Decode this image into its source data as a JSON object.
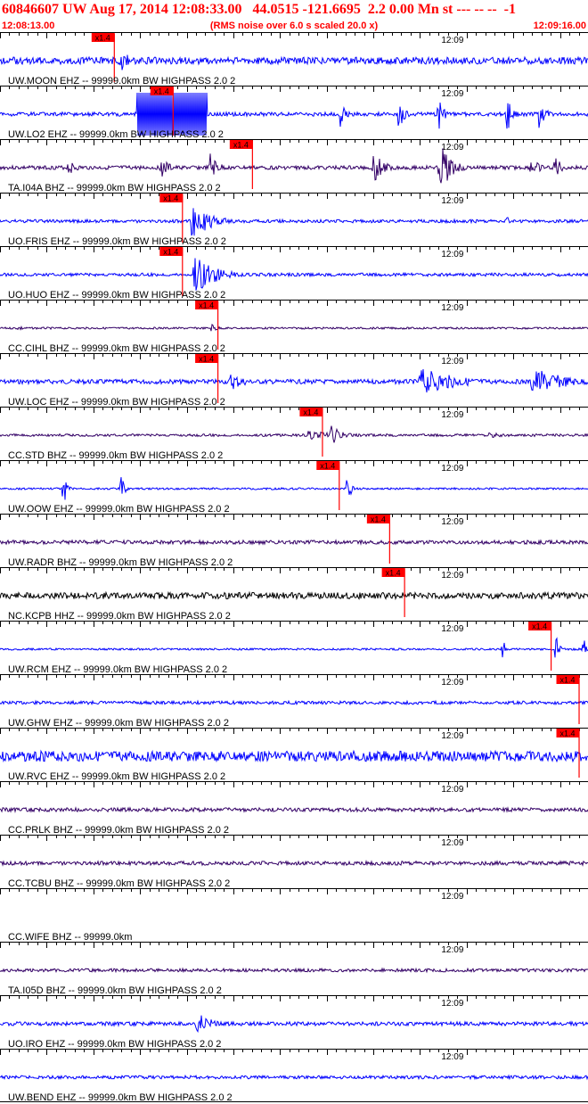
{
  "header": {
    "title": "60846607 UW Aug 17, 2014 12:08:33.00   44.0515 -121.6695  2.2 0.00 Mn st --- -- --  -1",
    "start_time": "12:08:13.00",
    "noise_note": "(RMS noise over 6.0 s scaled 20.0 x)",
    "end_time": "12:09:16.00"
  },
  "colors": {
    "header_text": "#ff0000",
    "trace_blue": "#0000ff",
    "trace_purple": "#330066",
    "trace_black": "#000000",
    "pick_marker": "#ff0000",
    "axis": "#000000"
  },
  "chart_data": {
    "type": "seismogram",
    "title": "60846607 UW Aug 17, 2014 12:08:33.00   44.0515 -121.6695  2.2 0.00 Mn st --- -- --  -1",
    "xlim": [
      "12:08:13.00",
      "12:09:16.00"
    ],
    "time_tick_label": "12:09",
    "pick_label": "x1.4",
    "grid": false,
    "traces": [
      {
        "label": "UW.MOON EHZ -- 99999.0km BW  HIGHPASS  2.0  2",
        "color": "#0000ff",
        "noise": 0.22,
        "pick": "12:08:25.2",
        "events": [
          {
            "t": "12:08:25.7",
            "amp": 1.0,
            "dur": 1.0
          }
        ]
      },
      {
        "label": "UW.LO2 EHZ -- 99999.0km BW  HIGHPASS  2.0  2",
        "color": "#0000ff",
        "noise": 0.12,
        "pick": "12:08:31.5",
        "clipped": true,
        "events": [
          {
            "t": "12:08:27.7",
            "t_end": "12:08:35.2",
            "amp": 3.0,
            "dur": 0.3,
            "saturated": true
          },
          {
            "t": "12:08:49.5",
            "amp": 1.3,
            "dur": 0.5
          },
          {
            "t": "12:08:55.7",
            "amp": 1.4,
            "dur": 0.5
          },
          {
            "t": "12:09:00.0",
            "amp": 1.3,
            "dur": 0.5
          },
          {
            "t": "12:09:07.3",
            "amp": 1.4,
            "dur": 0.5
          },
          {
            "t": "12:09:10.8",
            "amp": 1.3,
            "dur": 0.5
          }
        ]
      },
      {
        "label": "TA.I04A BHZ -- 99999.0km BW  HIGHPASS  2.0  2",
        "color": "#330066",
        "noise": 0.12,
        "pick": "12:08:40.0",
        "events": [
          {
            "t": "12:08:20.3",
            "amp": 0.5,
            "dur": 1.0
          },
          {
            "t": "12:08:30.3",
            "amp": 0.6,
            "dur": 1.0
          },
          {
            "t": "12:08:35.5",
            "amp": 1.0,
            "dur": 0.8
          },
          {
            "t": "12:08:53.0",
            "amp": 1.1,
            "dur": 1.0
          },
          {
            "t": "12:09:00.1",
            "amp": 1.6,
            "dur": 1.2
          },
          {
            "t": "12:09:09.9",
            "amp": 0.7,
            "dur": 0.8
          },
          {
            "t": "12:09:12.4",
            "amp": 1.0,
            "dur": 0.6
          }
        ]
      },
      {
        "label": "UO.FRIS EHZ -- 99999.0km BW  HIGHPASS  2.0  2",
        "color": "#0000ff",
        "noise": 0.1,
        "pick": "12:08:32.5",
        "events": [
          {
            "t": "12:08:33.5",
            "amp": 1.2,
            "dur": 2.0
          },
          {
            "t": "12:09:07.3",
            "amp": 0.3,
            "dur": 0.4
          }
        ]
      },
      {
        "label": "UO.HUO EHZ -- 99999.0km BW  HIGHPASS  2.0  2",
        "color": "#0000ff",
        "noise": 0.1,
        "pick": "12:08:32.5",
        "events": [
          {
            "t": "12:08:33.8",
            "amp": 1.4,
            "dur": 2.0
          }
        ]
      },
      {
        "label": "CC.CIHL BHZ -- 99999.0km BW  HIGHPASS  2.0  2",
        "color": "#330066",
        "noise": 0.06,
        "pick": "12:08:36.3",
        "events": [
          {
            "t": "12:08:15.0",
            "amp": 0.2,
            "dur": 0.6
          },
          {
            "t": "12:08:35.7",
            "amp": 0.35,
            "dur": 0.6
          }
        ]
      },
      {
        "label": "UW.LOC EHZ -- 99999.0km BW  HIGHPASS  2.0  2",
        "color": "#0000ff",
        "noise": 0.14,
        "pick": "12:08:36.3",
        "events": [
          {
            "t": "12:08:37.7",
            "amp": 0.6,
            "dur": 1.5
          },
          {
            "t": "12:08:58.0",
            "amp": 0.9,
            "dur": 4.0
          },
          {
            "t": "12:09:10.0",
            "amp": 0.9,
            "dur": 3.5
          }
        ]
      },
      {
        "label": "CC.STD BHZ -- 99999.0km BW  HIGHPASS  2.0  2",
        "color": "#330066",
        "noise": 0.08,
        "pick": "12:08:47.5",
        "events": [
          {
            "t": "12:08:48.5",
            "amp": 0.6,
            "dur": 1.2
          },
          {
            "t": "12:08:46.0",
            "amp": 0.3,
            "dur": 3.0
          },
          {
            "t": "12:09:05.5",
            "amp": 0.3,
            "dur": 1.0
          }
        ]
      },
      {
        "label": "UW.OOW EHZ -- 99999.0km BW  HIGHPASS  2.0  2",
        "color": "#0000ff",
        "noise": 0.06,
        "pick": "12:08:49.3",
        "events": [
          {
            "t": "12:08:19.8",
            "amp": 1.3,
            "dur": 0.3
          },
          {
            "t": "12:08:26.0",
            "amp": 1.0,
            "dur": 0.3
          },
          {
            "t": "12:08:50.2",
            "amp": 1.6,
            "dur": 0.3
          }
        ]
      },
      {
        "label": "UW.RADR BHZ -- 99999.0km BW  HIGHPASS  2.0  2",
        "color": "#330066",
        "noise": 0.12,
        "pick": "12:08:54.7",
        "events": []
      },
      {
        "label": "NC.KCPB HHZ -- 99999.0km BW  HIGHPASS  2.0  2",
        "color": "#000000",
        "noise": 0.2,
        "pick": "12:08:56.3",
        "events": [
          {
            "t": "12:08:57.5",
            "amp": 0.25,
            "dur": 3.0
          }
        ]
      },
      {
        "label": "UW.RCM EHZ -- 99999.0km BW  HIGHPASS  2.0  2",
        "color": "#0000ff",
        "noise": 0.06,
        "pick": "12:09:12.0",
        "events": [
          {
            "t": "12:09:06.7",
            "amp": 1.2,
            "dur": 0.3
          },
          {
            "t": "12:09:12.5",
            "amp": 1.2,
            "dur": 0.3
          },
          {
            "t": "12:09:15.5",
            "amp": 0.8,
            "dur": 0.3
          }
        ]
      },
      {
        "label": "UW.GHW EHZ -- 99999.0km BW  HIGHPASS  2.0  2",
        "color": "#0000ff",
        "noise": 0.1,
        "pick": "12:09:15.0",
        "events": []
      },
      {
        "label": "UW.RVC EHZ -- 99999.0km BW  HIGHPASS  2.0  2",
        "color": "#0000ff",
        "noise": 0.32,
        "pick": "12:09:15.0",
        "events": []
      },
      {
        "label": "CC.PRLK BHZ -- 99999.0km BW  HIGHPASS  2.0  2",
        "color": "#330066",
        "noise": 0.12,
        "pick": null,
        "events": []
      },
      {
        "label": "CC.TCBU BHZ -- 99999.0km BW  HIGHPASS  2.0  2",
        "color": "#330066",
        "noise": 0.12,
        "pick": null,
        "events": []
      },
      {
        "label": "CC.WIFE BHZ -- 99999.0km",
        "color": "#330066",
        "noise": 0.0,
        "pick": null,
        "events": []
      },
      {
        "label": "TA.I05D BHZ -- 99999.0km BW  HIGHPASS  2.0  2",
        "color": "#330066",
        "noise": 0.1,
        "pick": null,
        "events": []
      },
      {
        "label": "UO.IRO EHZ -- 99999.0km BW  HIGHPASS  2.0  2",
        "color": "#0000ff",
        "noise": 0.12,
        "pick": null,
        "events": [
          {
            "t": "12:08:34.0",
            "amp": 0.8,
            "dur": 1.5
          }
        ]
      },
      {
        "label": "UW.BEND EHZ -- 99999.0km BW  HIGHPASS  2.0  2",
        "color": "#0000ff",
        "noise": 0.1,
        "pick": null,
        "events": []
      }
    ]
  }
}
